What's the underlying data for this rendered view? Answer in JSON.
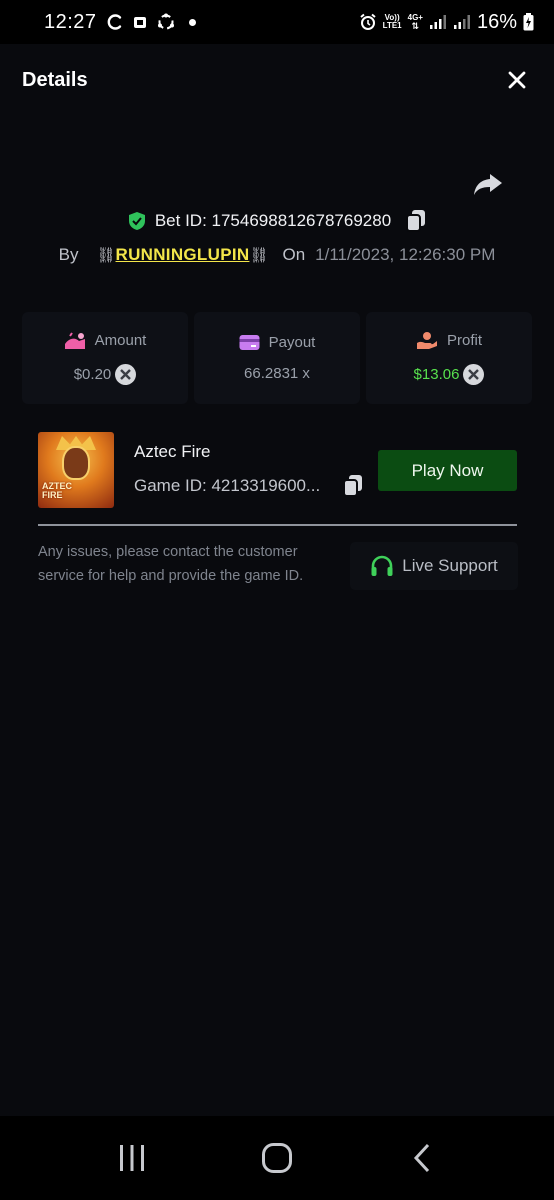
{
  "status_bar": {
    "time": "12:27",
    "network_top": "Vo))",
    "network_bottom": "LTE1",
    "network_gen": "4G+",
    "battery": "16%"
  },
  "header": {
    "title": "Details",
    "close_icon": "close-icon"
  },
  "bet": {
    "id_label": "Bet ID: 1754698812678769280",
    "by_label": "By",
    "chain_left": "⛓",
    "username": "RUNNINGLUPIN",
    "chain_right": "⛓",
    "on_label": "On",
    "date": "1/11/2023, 12:26:30 PM"
  },
  "stats": [
    {
      "label": "Amount",
      "value": "$0.20",
      "icon": "amount-icon"
    },
    {
      "label": "Payout",
      "value": "66.2831 x",
      "icon": "card-icon"
    },
    {
      "label": "Profit",
      "value": "$13.06",
      "icon": "profit-hand-icon",
      "color": "#58e14e"
    }
  ],
  "game": {
    "thumb_text_1": "AZTEC",
    "thumb_text_2": "FIRE",
    "name": "Aztec Fire",
    "game_id": "Game ID: 4213319600...",
    "play_label": "Play Now",
    "play_color": "#0b4c12"
  },
  "support": {
    "help_text": "Any issues, please contact the customer service for help and provide the game ID.",
    "label": "Live Support",
    "accent": "#3fd15a"
  },
  "colors": {
    "background": "#090a0e",
    "username": "#f3e64a",
    "shield": "#2fc25b"
  }
}
